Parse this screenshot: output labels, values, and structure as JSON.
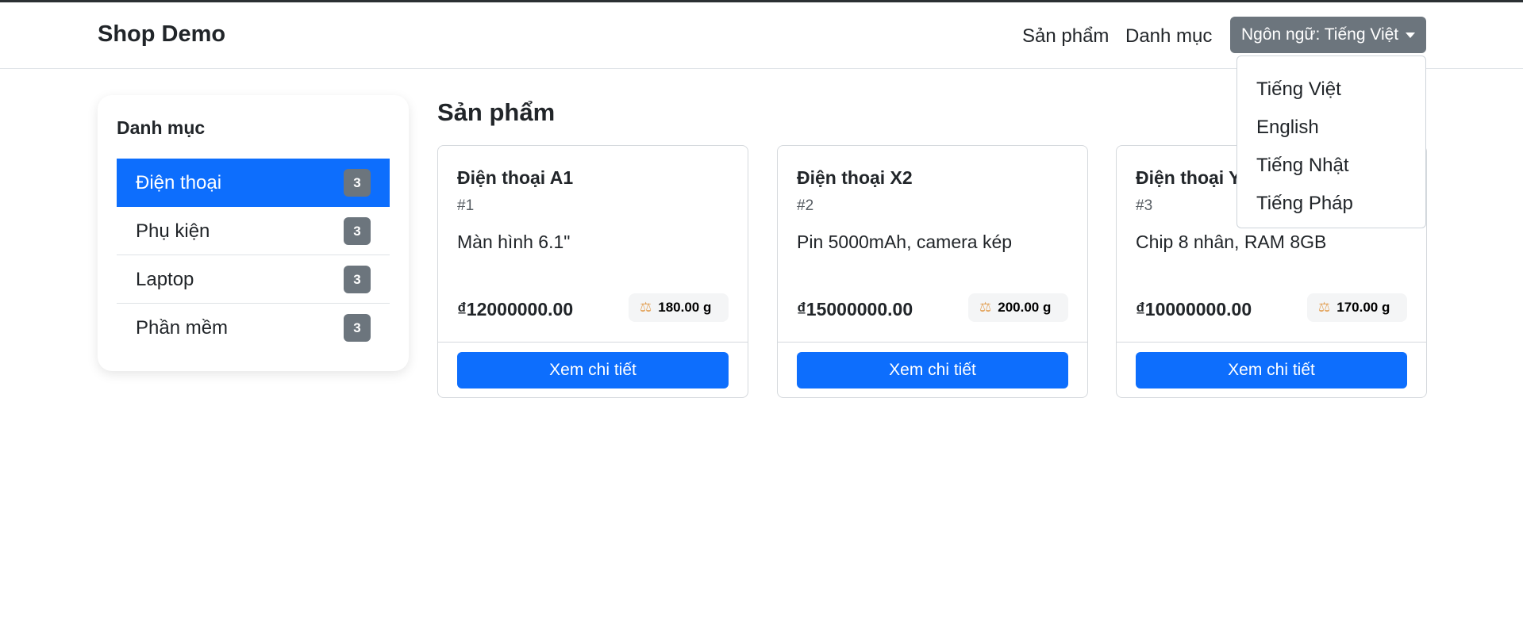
{
  "navbar": {
    "brand": "Shop Demo",
    "links": [
      "Sản phẩm",
      "Danh mục"
    ],
    "language_button": "Ngôn ngữ: Tiếng Việt"
  },
  "language_menu": {
    "items": [
      "Tiếng Việt",
      "English",
      "Tiếng Nhật",
      "Tiếng Pháp"
    ]
  },
  "sidebar": {
    "title": "Danh mục",
    "items": [
      {
        "label": "Điện thoại",
        "count": "3",
        "active": true
      },
      {
        "label": "Phụ kiện",
        "count": "3",
        "active": false
      },
      {
        "label": "Laptop",
        "count": "3",
        "active": false
      },
      {
        "label": "Phần mềm",
        "count": "3",
        "active": false
      }
    ]
  },
  "main": {
    "title": "Sản phẩm",
    "products": [
      {
        "name": "Điện thoại A1",
        "id": "#1",
        "description": "Màn hình 6.1\"",
        "price": "₫12000000.00",
        "weight": "180.00 g",
        "button": "Xem chi tiết"
      },
      {
        "name": "Điện thoại X2",
        "id": "#2",
        "description": "Pin 5000mAh, camera kép",
        "price": "₫15000000.00",
        "weight": "200.00 g",
        "button": "Xem chi tiết"
      },
      {
        "name": "Điện thoại Y",
        "id": "#3",
        "description": "Chip 8 nhân, RAM 8GB",
        "price": "₫10000000.00",
        "weight": "170.00 g",
        "button": "Xem chi tiết"
      }
    ]
  },
  "icons": {
    "weight": "scale-icon",
    "language_caret": "caret-down-icon"
  },
  "colors": {
    "primary": "#0d6efd",
    "secondary": "#6c757d",
    "text": "#212529"
  }
}
